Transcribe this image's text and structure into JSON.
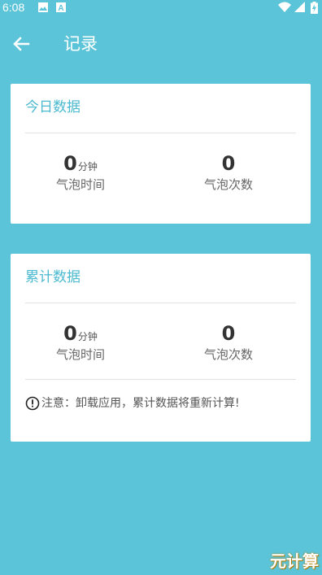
{
  "status_bar": {
    "time": "6:08",
    "icons": [
      "image-icon",
      "a-icon",
      "wifi-icon",
      "signal-icon",
      "battery-icon"
    ]
  },
  "app_bar": {
    "title": "记录",
    "back_icon": "arrow-left-icon"
  },
  "today_card": {
    "title": "今日数据",
    "bubble_time": {
      "value": "0",
      "unit": "分钟",
      "label": "气泡时间"
    },
    "bubble_count": {
      "value": "0",
      "label": "气泡次数"
    }
  },
  "total_card": {
    "title": "累计数据",
    "bubble_time": {
      "value": "0",
      "unit": "分钟",
      "label": "气泡时间"
    },
    "bubble_count": {
      "value": "0",
      "label": "气泡次数"
    },
    "notice": "注意：卸载应用，累计数据将重新计算!"
  },
  "watermark": "元计算",
  "colors": {
    "background": "#5bc4d8",
    "card": "#ffffff",
    "accent": "#4bb9cf",
    "text_dark": "#333333",
    "text_muted": "#666666"
  }
}
